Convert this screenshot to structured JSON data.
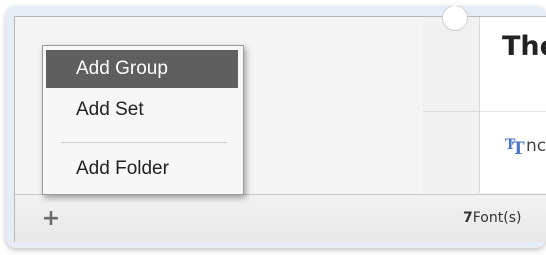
{
  "context_menu": {
    "items": [
      {
        "label": "Add Group",
        "selected": true
      },
      {
        "label": "Add Set",
        "selected": false
      },
      {
        "label": "Add Folder",
        "selected": false
      }
    ]
  },
  "preview": {
    "title_text": "The",
    "sample_text": "nc",
    "font_icon": "font-type-icon",
    "font_icon_glyphs": [
      "T",
      "T"
    ],
    "icon_color": "#4a78c9"
  },
  "status_bar": {
    "add_icon": "plus-icon",
    "add_glyph": "+",
    "font_count_number": "7",
    "font_count_label": "Font(s)"
  },
  "colors": {
    "menu_highlight": "#5f5f5f",
    "frame_background": "#e6edf7"
  }
}
